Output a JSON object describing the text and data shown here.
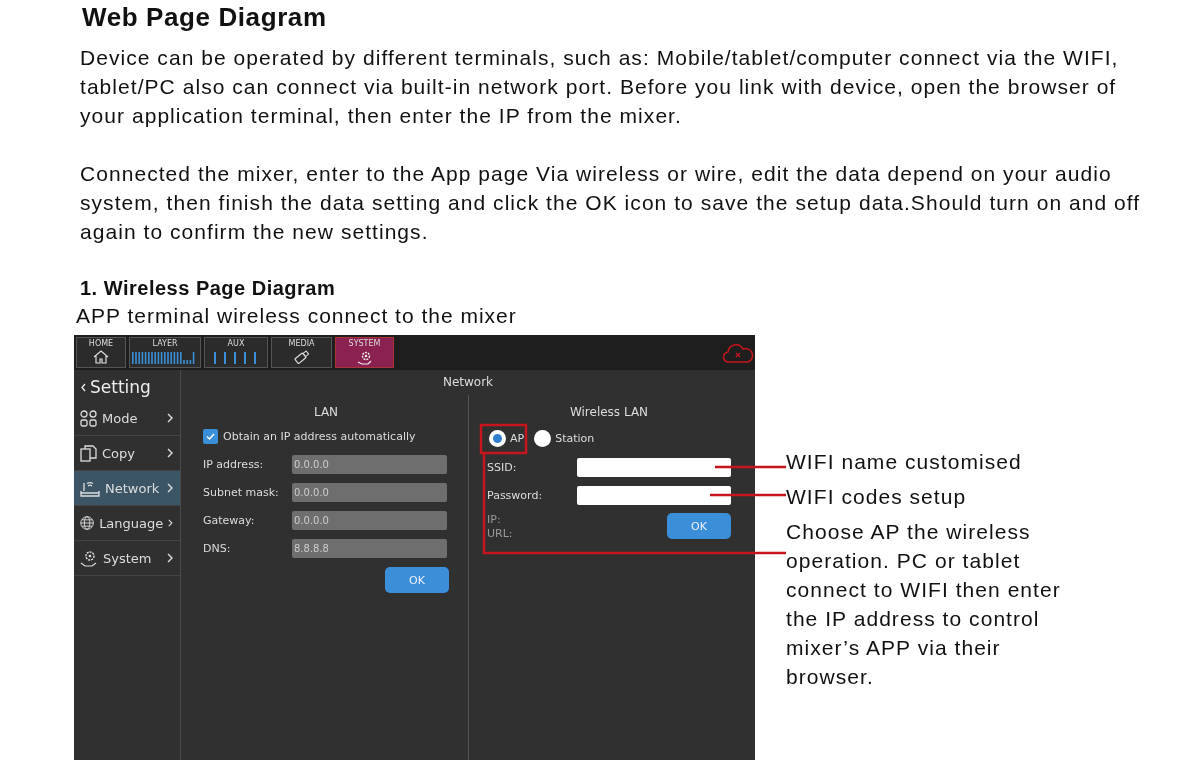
{
  "heading": "Web Page Diagram",
  "paragraphs": [
    "Device can be operated by different terminals, such as: Mobile/tablet/computer connect via the WIFI, tablet/PC also can connect via built-in network port. Before you link with device, open the browser of your application terminal, then enter the IP from the mixer.",
    "Connected the mixer, enter to the App page Via wireless or wire, edit the data depend on your audio system, then finish the data setting and click the OK icon to save the setup data.Should turn on and off again to confirm the new settings."
  ],
  "section": {
    "title": "1. Wireless Page Diagram",
    "caption": "APP terminal wireless connect to the mixer"
  },
  "app": {
    "top_tabs": [
      {
        "label": "HOME",
        "kind": "home",
        "selected": false
      },
      {
        "label": "LAYER",
        "kind": "layer",
        "selected": false
      },
      {
        "label": "AUX",
        "kind": "aux",
        "selected": false
      },
      {
        "label": "MEDIA",
        "kind": "media",
        "selected": false
      },
      {
        "label": "SYSTEM",
        "kind": "system",
        "selected": true
      }
    ],
    "sidebar": {
      "title": "Setting",
      "items": [
        {
          "label": "Mode",
          "kind": "mode",
          "selected": false
        },
        {
          "label": "Copy",
          "kind": "copy",
          "selected": false
        },
        {
          "label": "Network",
          "kind": "network",
          "selected": true
        },
        {
          "label": "Language",
          "kind": "language",
          "selected": false
        },
        {
          "label": "System",
          "kind": "system",
          "selected": false
        }
      ]
    },
    "page_title": "Network",
    "lan": {
      "title": "LAN",
      "auto_ip": {
        "label": "Obtain an IP address automatically",
        "checked": true
      },
      "fields": [
        {
          "label": "IP address:",
          "value": "0.0.0.0"
        },
        {
          "label": "Subnet mask:",
          "value": "0.0.0.0"
        },
        {
          "label": "Gateway:",
          "value": "0.0.0.0"
        },
        {
          "label": "DNS:",
          "value": "8.8.8.8"
        }
      ],
      "ok": "OK"
    },
    "wireless": {
      "title": "Wireless LAN",
      "modes": [
        {
          "label": "AP",
          "selected": true
        },
        {
          "label": "Station",
          "selected": false
        }
      ],
      "fields": [
        {
          "label": "SSID:"
        },
        {
          "label": "Password:"
        }
      ],
      "info": [
        "IP:",
        "URL:"
      ],
      "ok": "OK"
    }
  },
  "callouts": [
    "WIFI name customised",
    "WIFI codes setup",
    "Choose AP the wireless operation. PC or tablet connect to WIFI then enter the IP address to control mixer’s APP via their browser."
  ]
}
